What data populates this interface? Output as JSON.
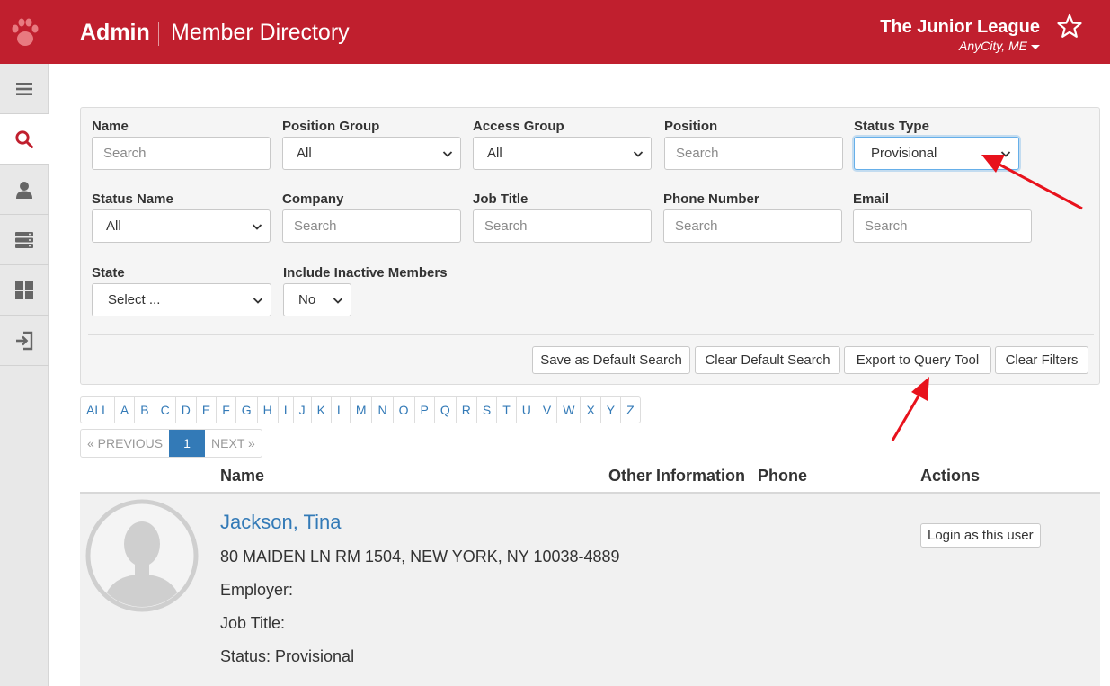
{
  "header": {
    "brand": "Admin",
    "page_title": "Member Directory",
    "org_name": "The Junior League",
    "org_city": "AnyCity, ME",
    "color": "#c01f2e"
  },
  "sidebar": {
    "items": [
      {
        "icon": "hamburger-menu-icon"
      },
      {
        "icon": "search-icon",
        "active": true
      },
      {
        "icon": "user-icon"
      },
      {
        "icon": "server-list-icon"
      },
      {
        "icon": "grid-dashboard-icon"
      },
      {
        "icon": "logout-icon"
      }
    ]
  },
  "filters": {
    "name": {
      "label": "Name",
      "placeholder": "Search"
    },
    "position_group": {
      "label": "Position Group",
      "value": "All"
    },
    "access_group": {
      "label": "Access Group",
      "value": "All"
    },
    "position": {
      "label": "Position",
      "placeholder": "Search"
    },
    "status_type": {
      "label": "Status Type",
      "value": "Provisional"
    },
    "status_name": {
      "label": "Status Name",
      "value": "All"
    },
    "company": {
      "label": "Company",
      "placeholder": "Search"
    },
    "job_title": {
      "label": "Job Title",
      "placeholder": "Search"
    },
    "phone": {
      "label": "Phone Number",
      "placeholder": "Search"
    },
    "email": {
      "label": "Email",
      "placeholder": "Search"
    },
    "state": {
      "label": "State",
      "value": "Select ..."
    },
    "inactive": {
      "label": "Include Inactive Members",
      "value": "No"
    }
  },
  "buttons": {
    "save_default": "Save as Default Search",
    "clear_default": "Clear Default Search",
    "export": "Export to Query Tool",
    "clear_filters": "Clear Filters"
  },
  "alphabet": [
    "ALL",
    "A",
    "B",
    "C",
    "D",
    "E",
    "F",
    "G",
    "H",
    "I",
    "J",
    "K",
    "L",
    "M",
    "N",
    "O",
    "P",
    "Q",
    "R",
    "S",
    "T",
    "U",
    "V",
    "W",
    "X",
    "Y",
    "Z"
  ],
  "pagination": {
    "prev": "« PREVIOUS",
    "current": "1",
    "next": "NEXT »"
  },
  "table": {
    "headers": {
      "name": "Name",
      "other": "Other Information",
      "phone": "Phone",
      "actions": "Actions"
    }
  },
  "member": {
    "name": "Jackson, Tina",
    "address": "80 MAIDEN LN RM 1504, NEW YORK, NY 10038-4889",
    "employer": "Employer:",
    "job_title": "Job Title:",
    "status": "Status: Provisional",
    "login_label": "Login as this user"
  },
  "annotation_color": "#e8121c"
}
